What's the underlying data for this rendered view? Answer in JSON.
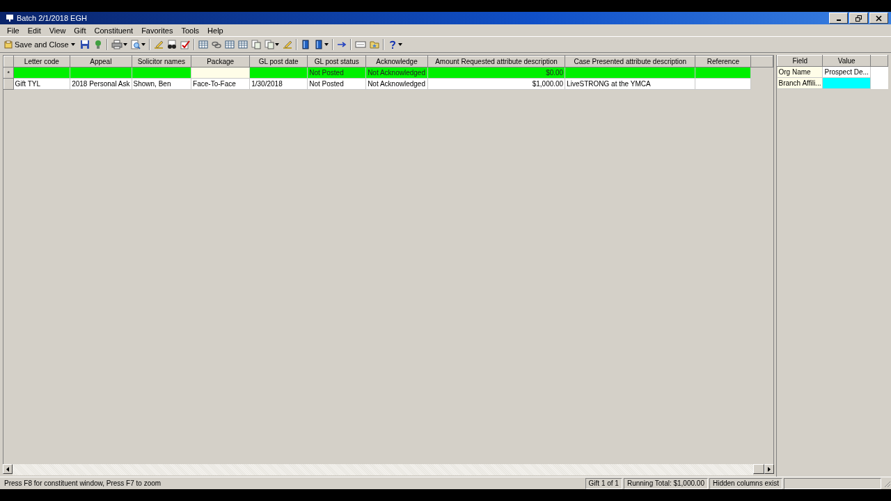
{
  "window": {
    "title": "Batch 2/1/2018 EGH"
  },
  "menu": [
    "File",
    "Edit",
    "View",
    "Gift",
    "Constituent",
    "Favorites",
    "Tools",
    "Help"
  ],
  "toolbar": {
    "save_button": "Save and Close"
  },
  "grid": {
    "columns": [
      "Letter code",
      "Appeal",
      "Solicitor names",
      "Package",
      "GL post date",
      "GL post status",
      "Acknowledge",
      "Amount Requested attribute description",
      "Case Presented attribute description",
      "Reference"
    ],
    "rows": [
      {
        "marker": "*",
        "selected": true,
        "cells": [
          {
            "current": false
          },
          {
            "current": false
          },
          {
            "current": false
          },
          {
            "current": true
          },
          {
            "current": false
          },
          {
            "text": "Not Posted",
            "current": false
          },
          {
            "text": "Not Acknowledged",
            "current": false
          },
          {
            "text": "$0.00",
            "current": false
          },
          {
            "current": false
          },
          {
            "current": false
          }
        ]
      },
      {
        "selected": false,
        "cells": [
          {
            "text": "Gift TYL",
            "current": false
          },
          {
            "text": "2018 Personal Ask",
            "current": false
          },
          {
            "text": "Shown, Ben",
            "current": false
          },
          {
            "text": "Face-To-Face",
            "current": false
          },
          {
            "text": "1/30/2018",
            "current": false
          },
          {
            "text": "Not Posted",
            "current": false
          },
          {
            "text": "Not Acknowledged",
            "current": false
          },
          {
            "text": "$1,000.00",
            "current": false
          },
          {
            "text": "LiveSTRONG at the YMCA",
            "current": false
          },
          {
            "current": false
          }
        ]
      }
    ]
  },
  "side_panel": {
    "columns": [
      "Field",
      "Value"
    ],
    "rows": [
      {
        "field": "Org Name",
        "value": "Prospect De...",
        "selected": false
      },
      {
        "field": "Branch Affili...",
        "selected": true
      }
    ]
  },
  "status_bar": {
    "message": "Press F8 for constituent window, Press F7 to zoom",
    "panes": [
      "Gift 1 of 1",
      "Running Total: $1,000.00",
      "Hidden columns exist"
    ]
  }
}
